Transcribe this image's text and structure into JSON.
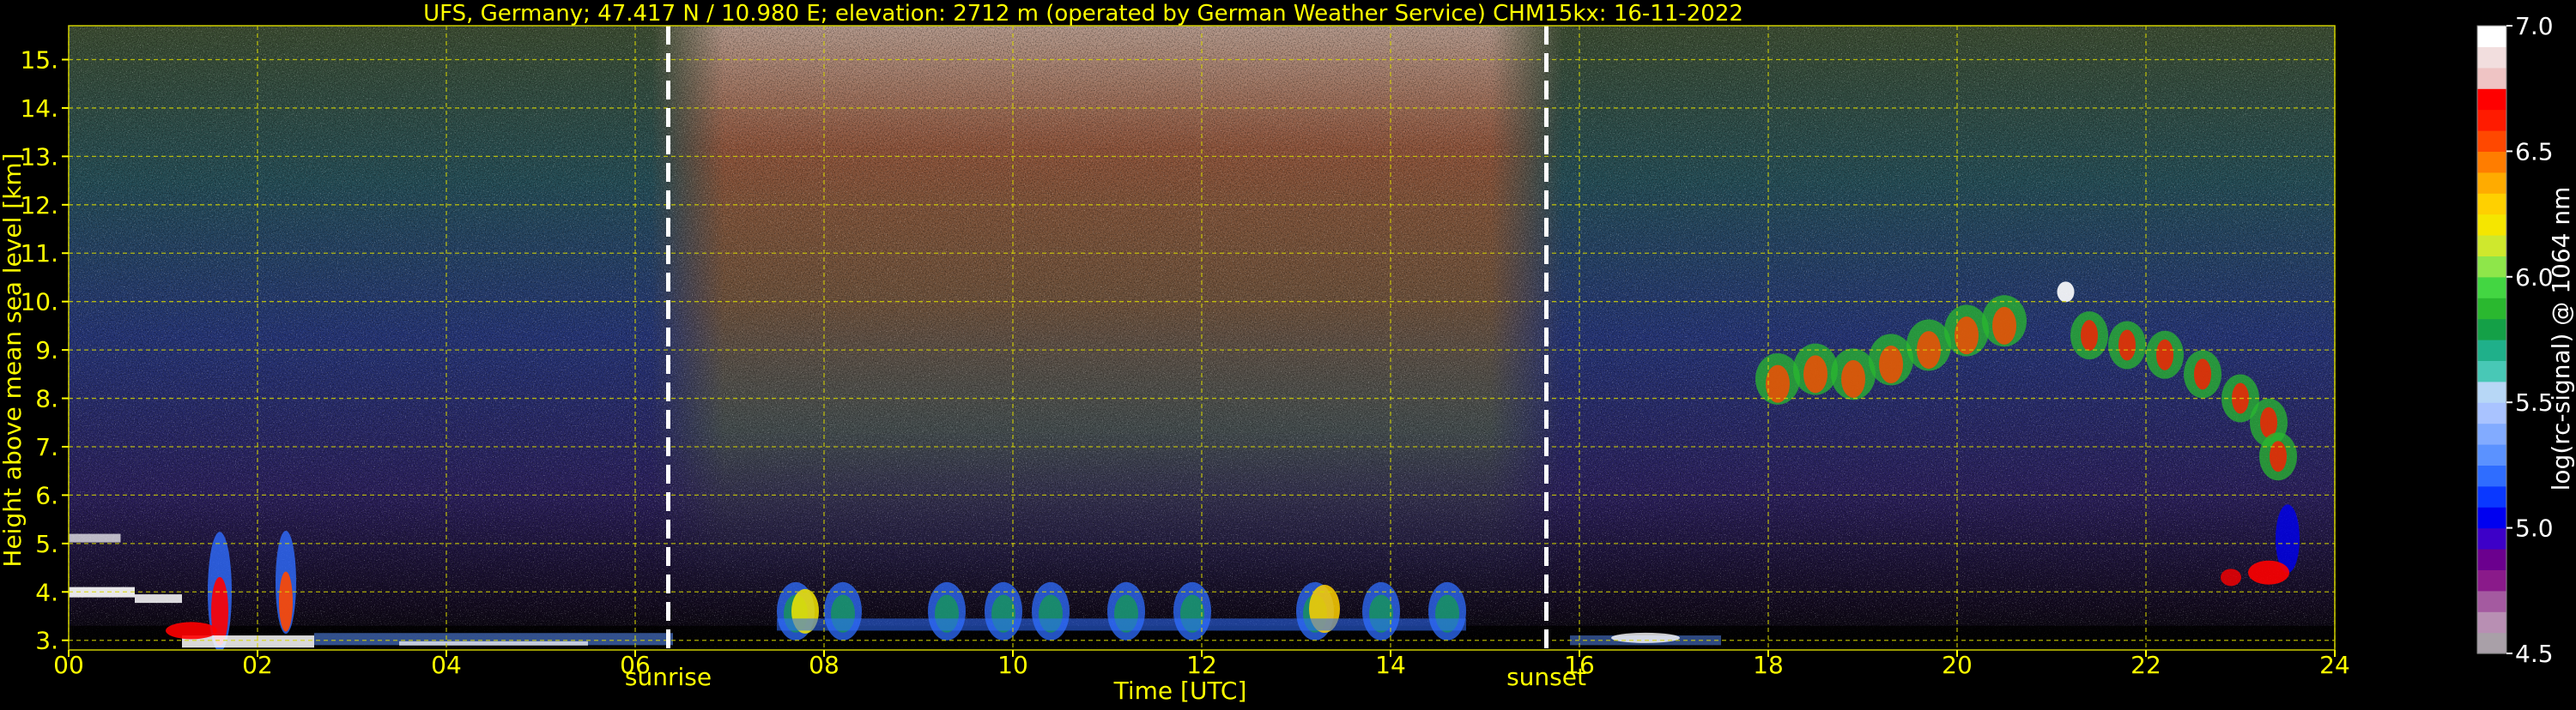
{
  "chart_data": {
    "type": "heatmap",
    "title": "UFS, Germany; 47.417 N / 10.980 E; elevation: 2712 m  (operated by German Weather Service)    CHM15kx: 16-11-2022",
    "xlabel": "Time [UTC]",
    "ylabel": "Height above mean sea level [km]",
    "xlim": [
      0,
      24
    ],
    "ylim": [
      2.8,
      15.7
    ],
    "x_ticks": [
      "00",
      "02",
      "04",
      "06",
      "08",
      "10",
      "12",
      "14",
      "16",
      "18",
      "20",
      "22",
      "24"
    ],
    "y_ticks": [
      "3.",
      "4.",
      "5.",
      "6.",
      "7.",
      "8.",
      "9.",
      "10.",
      "11.",
      "12.",
      "13.",
      "14.",
      "15."
    ],
    "grid": true,
    "markers": [
      {
        "label": "sunrise",
        "x": 6.35
      },
      {
        "label": "sunset",
        "x": 15.65
      }
    ],
    "colorbar": {
      "label": "log(rc-signal) @ 1064 nm",
      "range": [
        4.5,
        7.0
      ],
      "ticks": [
        "4.5",
        "5.0",
        "5.5",
        "6.0",
        "6.5",
        "7.0"
      ],
      "colors": [
        "#a9a0a8",
        "#b88fb3",
        "#a45aa0",
        "#8a1a8a",
        "#6b008e",
        "#3d00c8",
        "#0000f0",
        "#0a38ff",
        "#2f6dff",
        "#5b92ff",
        "#82abff",
        "#a9c3ff",
        "#b7d7f6",
        "#48c8b6",
        "#1fb08a",
        "#14a047",
        "#2ab82f",
        "#43d642",
        "#8ee64a",
        "#cfe82d",
        "#f5e600",
        "#ffd000",
        "#ffab00",
        "#ff7d00",
        "#ff4800",
        "#ff1b00",
        "#ff0000",
        "#efc4c4",
        "#f2dede",
        "#ffffff"
      ]
    },
    "accent_color": "#ffff00"
  }
}
